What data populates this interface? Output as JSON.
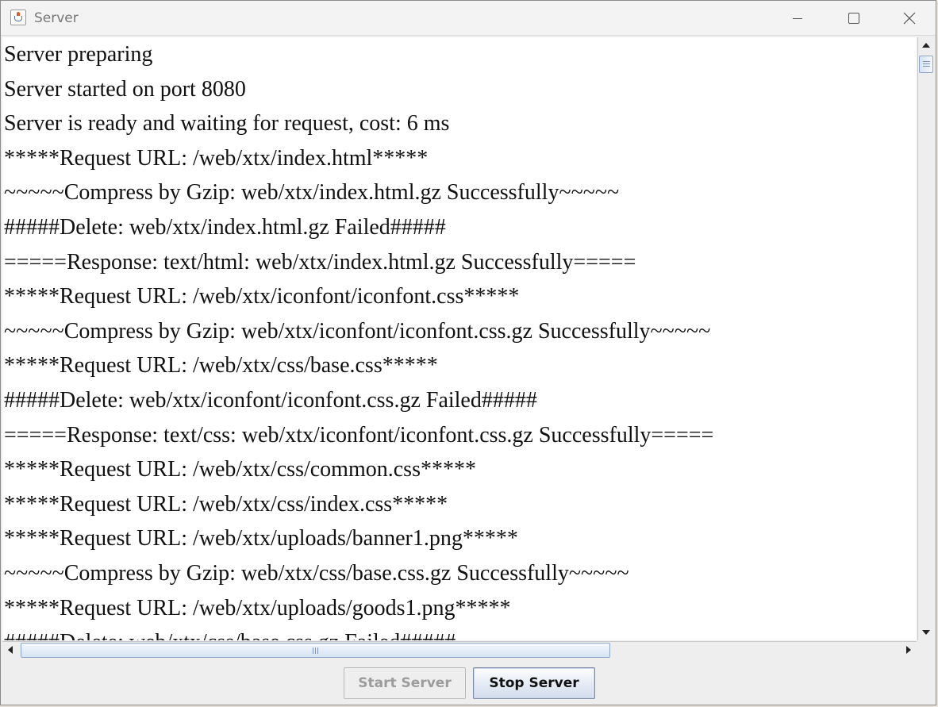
{
  "window": {
    "title": "Server"
  },
  "log": {
    "lines": [
      "Server preparing",
      "Server started on port 8080",
      "Server is ready and waiting for request, cost: 6 ms",
      "*****Request URL: /web/xtx/index.html*****",
      "~~~~~Compress by Gzip: web/xtx/index.html.gz Successfully~~~~~",
      "#####Delete: web/xtx/index.html.gz Failed#####",
      "=====Response: text/html: web/xtx/index.html.gz Successfully=====",
      "*****Request URL: /web/xtx/iconfont/iconfont.css*****",
      "~~~~~Compress by Gzip: web/xtx/iconfont/iconfont.css.gz Successfully~~~~~",
      "*****Request URL: /web/xtx/css/base.css*****",
      "#####Delete: web/xtx/iconfont/iconfont.css.gz Failed#####",
      "=====Response: text/css: web/xtx/iconfont/iconfont.css.gz Successfully=====",
      "*****Request URL: /web/xtx/css/common.css*****",
      "*****Request URL: /web/xtx/css/index.css*****",
      "*****Request URL: /web/xtx/uploads/banner1.png*****",
      "~~~~~Compress by Gzip: web/xtx/css/base.css.gz Successfully~~~~~",
      "*****Request URL: /web/xtx/uploads/goods1.png*****",
      "#####Delete: web/xtx/css/base.css.gz Failed#####"
    ]
  },
  "buttons": {
    "start": "Start Server",
    "stop": "Stop Server"
  },
  "state": {
    "start_enabled": false,
    "stop_enabled": true
  },
  "icons": {
    "window_icon": "java-cup-icon",
    "minimize": "minimize-icon",
    "maximize": "maximize-icon",
    "close": "close-icon"
  },
  "colors": {
    "disabled_text": "#9c9c9c",
    "button_gradient": "#d2dcec",
    "thumb_border": "#8ea6c8"
  }
}
